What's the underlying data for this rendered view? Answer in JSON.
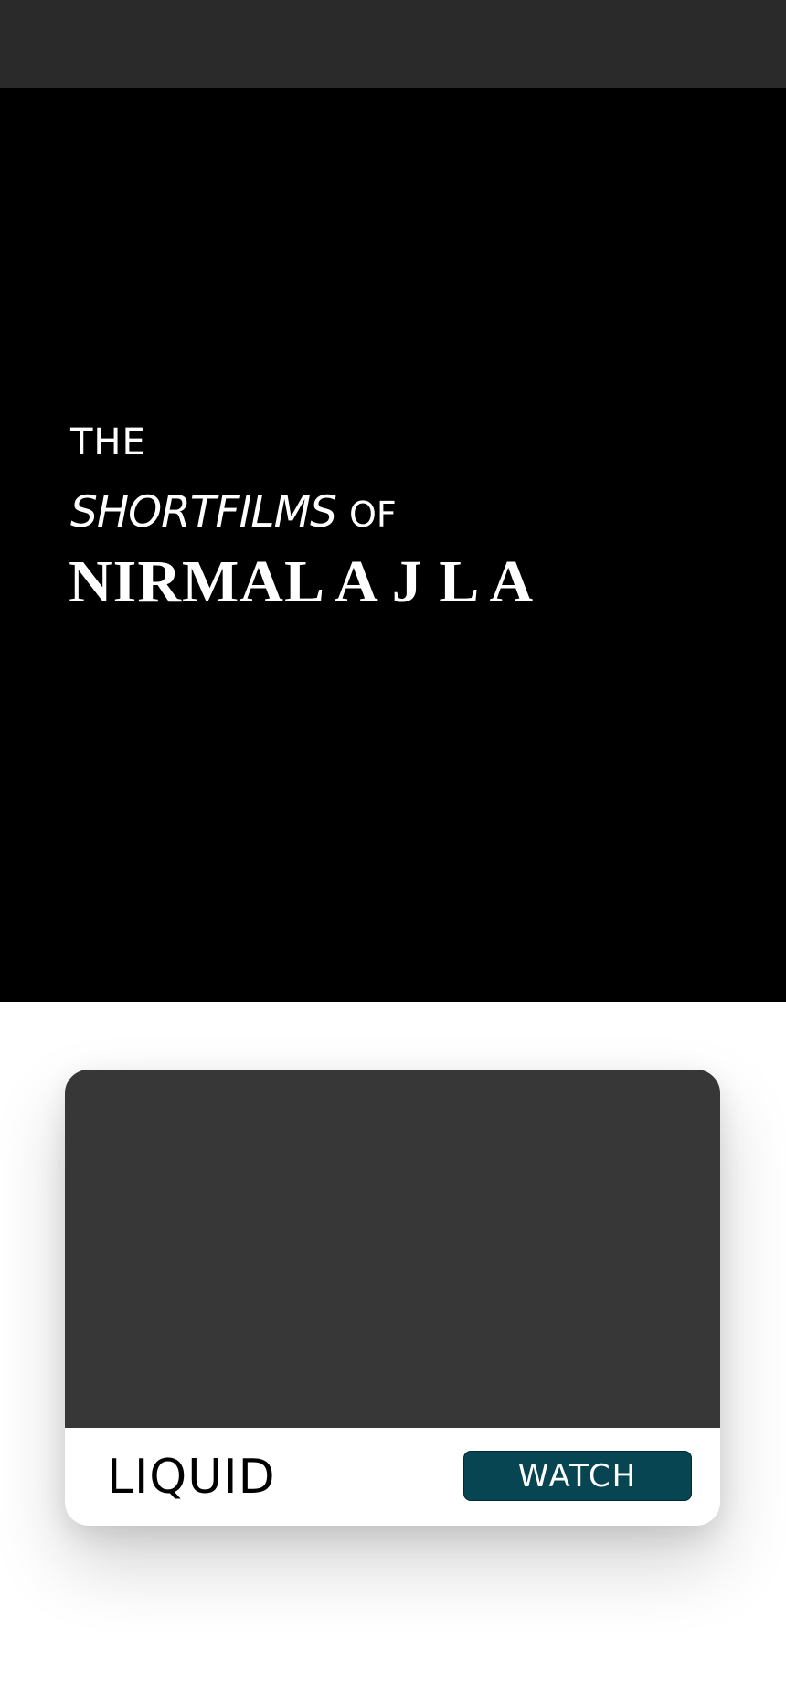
{
  "hero": {
    "line1": "THE",
    "line2_emphasis": "SHORTFILMS",
    "line2_suffix": "OF",
    "name": "NIRMAL A J L A"
  },
  "film_card": {
    "title": "LIQUID",
    "watch_label": "WATCH"
  },
  "colors": {
    "topbar": "#2a2a2a",
    "hero_background": "#000000",
    "thumbnail": "#373737",
    "watch_button": "#064551"
  }
}
